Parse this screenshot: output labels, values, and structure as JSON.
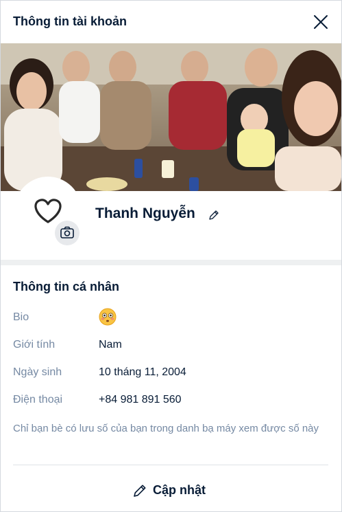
{
  "header": {
    "title": "Thông tin tài khoản"
  },
  "profile": {
    "display_name": "Thanh Nguyễn"
  },
  "personal_info": {
    "section_title": "Thông tin cá nhân",
    "bio_label": "Bio",
    "gender_label": "Giới tính",
    "gender_value": "Nam",
    "birthday_label": "Ngày sinh",
    "birthday_value": "10 tháng 11, 2004",
    "phone_label": "Điện thoại",
    "phone_value": "+84 981 891 560",
    "phone_note": "Chỉ bạn bè có lưu số của bạn trong danh bạ máy xem được số này"
  },
  "footer": {
    "update_label": "Cập nhật"
  },
  "icons": {
    "close": "close-icon",
    "avatar": "heart-icon",
    "camera": "camera-icon",
    "edit": "pencil-icon",
    "bio_emoji": "flushed-face-emoji",
    "update": "pencil-icon"
  },
  "colors": {
    "text_primary": "#081c36",
    "text_secondary": "#7589a3",
    "divider": "#eef0f1",
    "camera_bg": "#e7e9ec"
  }
}
